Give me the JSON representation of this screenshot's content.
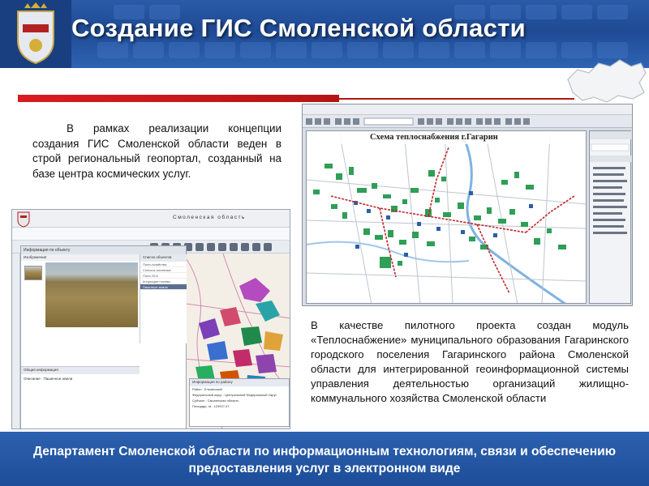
{
  "slide": {
    "title": "Создание ГИС Смоленской области",
    "intro_text": "В рамках реализации концепции создания ГИС Смоленской области веден в строй региональный геопортал, созданный на базе центра космических услуг.",
    "pilot_text": "В качестве пилотного проекта создан модуль «Теплоснабжение» муниципального образования Гагаринского городского поселения Гагаринского района Смоленской области для интегрированной геоинформационной системы управления деятельностью организаций жилищно-коммунального хозяйства Смоленской области",
    "footer_text": "Департамент Смоленской области по информационным технологиям, связи и обеспечению предоставления услуг в электронном виде"
  },
  "heat_screenshot": {
    "map_title": "Схема теплоснабжения г.Гагарин"
  },
  "portal_screenshot": {
    "header_title": "Смоленская область",
    "info_title": "Информация по объекту",
    "photo_tab": "Изображения",
    "layers_header": "Список объектов",
    "layers": [
      "Поля-хозяйства",
      "Сельхоз-посевные",
      "Поля 2011",
      "Кочующие посевы",
      "Пахотные земли"
    ],
    "selected_layer": "Пахотные земли",
    "general_info_header": "Общая информация",
    "general_info_line": "Описание : Пашенное земли",
    "region_info_header": "Информация по району",
    "region_info_lines": [
      "Район : Ельнинский",
      "Федеральный округ : Центральный Федеральный Округ",
      "Субъект : Смоленская область",
      "Площадь, га : 123927,47"
    ]
  },
  "colors": {
    "header_blue": "#1f4a94",
    "accent_red": "#d81c20",
    "footer_blue": "#1d4d98"
  }
}
